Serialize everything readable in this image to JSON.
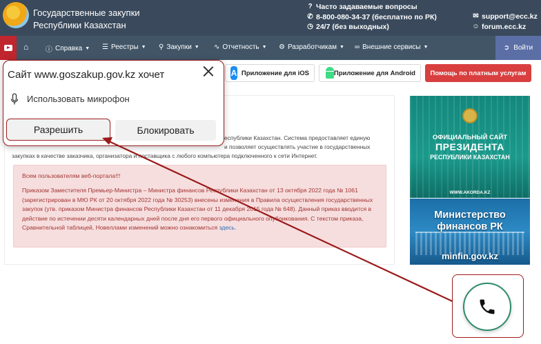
{
  "header": {
    "title_line1": "Государственные закупки",
    "title_line2": "Республики Казахстан",
    "faq_label": "Часто задаваемые вопросы",
    "phone": "8-800-080-34-37 (бесплатно по РК)",
    "hours": "24/7 (без выходных)",
    "email": "support@ecc.kz",
    "forum": "forum.ecc.kz"
  },
  "nav": {
    "items": [
      {
        "label": "Справка",
        "icon": "question-circle-icon"
      },
      {
        "label": "Реестры",
        "icon": "layers-icon"
      },
      {
        "label": "Закупки",
        "icon": "search-icon"
      },
      {
        "label": "Отчетность",
        "icon": "chart-line-icon"
      },
      {
        "label": "Разработчикам",
        "icon": "wrench-icon"
      },
      {
        "label": "Внешние сервисы",
        "icon": "link-icon"
      }
    ],
    "login": "Войти"
  },
  "toolbar": {
    "ios": "Приложение для iOS",
    "android": "Приложение для Android",
    "help": "Помощь по платным услугам"
  },
  "content": {
    "intro": "еспублики Казахстан. Система предоставляет единую\nи позволяет осуществлять участие в государственных\nзакупках в качестве заказчика, организатора и поставщика с любого компьютера подключенного к сети Интернет.",
    "alert_heading": "Всем пользователям веб-портала!!!",
    "alert_body": "Приказом Заместителя Премьер-Министра – Министра финансов Республики Казахстан от 13 октября 2022 года № 1061 (зарегистрирован в МЮ РК от 20 октября 2022 года № 30253) внесены изменения в Правила осуществления государственных закупок (утв. приказом Министра финансов Республики Казахстан от 11 декабря 2015 года № 648). Данный приказ вводится в действие по истечении десяти календарных дней после дня его первого официального опубликования. С текстом приказа, Сравнительной таблицей, Новеллами изменений можно ознакомиться ",
    "alert_link": "здесь",
    "alert_end": "."
  },
  "banners": {
    "akorda_line1": "ОФИЦИАЛЬНЫЙ САЙТ",
    "akorda_line2": "ПРЕЗИДЕНТА",
    "akorda_line3": "РЕСПУБЛИКИ КАЗАХСТАН",
    "akorda_url": "WWW.AKORDA.KZ",
    "minfin_title": "Министерство\nфинансов РК",
    "minfin_url": "minfin.gov.kz"
  },
  "popup": {
    "title": "Сайт www.goszakup.gov.kz хочет",
    "permission": "Использовать микрофон",
    "allow": "Разрешить",
    "block": "Блокировать"
  },
  "colors": {
    "header_bg": "#3a4a5c",
    "nav_bg": "#415567",
    "login_bg": "#5b6fa6",
    "help_button": "#d93f3f",
    "alert_bg": "#f7dede",
    "alert_text": "#a13533",
    "annotation": "#9b1a1a",
    "call_ring": "#2d8a6a"
  }
}
